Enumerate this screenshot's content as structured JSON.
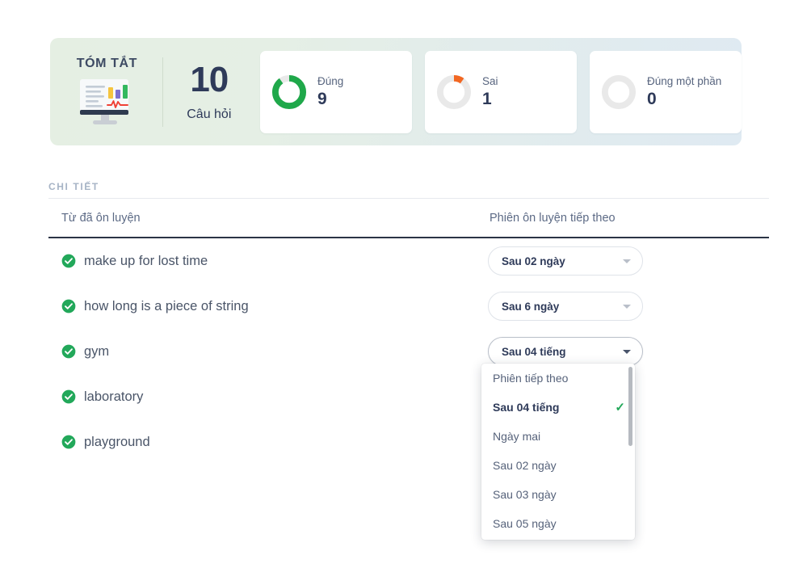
{
  "summary": {
    "title": "TÓM TẮT",
    "icon": "monitor-chart-icon",
    "total_count": "10",
    "total_label": "Câu hỏi",
    "cards": [
      {
        "label": "Đúng",
        "value": "9",
        "color": "#1fa84a",
        "percent": 90,
        "icon": "donut-chart-correct"
      },
      {
        "label": "Sai",
        "value": "1",
        "color": "#f26722",
        "percent": 10,
        "icon": "donut-chart-wrong"
      },
      {
        "label": "Đúng một phần",
        "value": "0",
        "color": "#e9e9e9",
        "percent": 0,
        "icon": "donut-chart-partial"
      }
    ]
  },
  "details": {
    "section_label": "CHI TIẾT",
    "columns": {
      "word": "Từ đã ôn luyện",
      "next_session": "Phiên ôn luyện tiếp theo"
    },
    "rows": [
      {
        "word": "make up for lost time",
        "status_icon": "check-circle-icon",
        "next_session": "Sau 02 ngày",
        "active": false
      },
      {
        "word": "how long is a piece of string",
        "status_icon": "check-circle-icon",
        "next_session": "Sau 6 ngày",
        "active": false
      },
      {
        "word": "gym",
        "status_icon": "check-circle-icon",
        "next_session": "Sau 04 tiếng",
        "active": true
      },
      {
        "word": "laboratory",
        "status_icon": "check-circle-icon",
        "next_session": "",
        "active": false
      },
      {
        "word": "playground",
        "status_icon": "check-circle-icon",
        "next_session": "",
        "active": false
      }
    ]
  },
  "dropdown": {
    "open": true,
    "opened_for_row": 2,
    "items": [
      {
        "label": "Phiên tiếp theo",
        "selected": false
      },
      {
        "label": "Sau 04 tiếng",
        "selected": true
      },
      {
        "label": "Ngày mai",
        "selected": false
      },
      {
        "label": "Sau 02 ngày",
        "selected": false
      },
      {
        "label": "Sau 03 ngày",
        "selected": false
      },
      {
        "label": "Sau 05 ngày",
        "selected": false
      }
    ],
    "check_glyph": "✓"
  },
  "colors": {
    "correct_green": "#1fa84a",
    "wrong_orange": "#f26722",
    "neutral_grey": "#e9e9e9",
    "text_navy": "#2e3a59",
    "banner_start": "#e5efe3",
    "banner_end": "#dfeaf2"
  }
}
